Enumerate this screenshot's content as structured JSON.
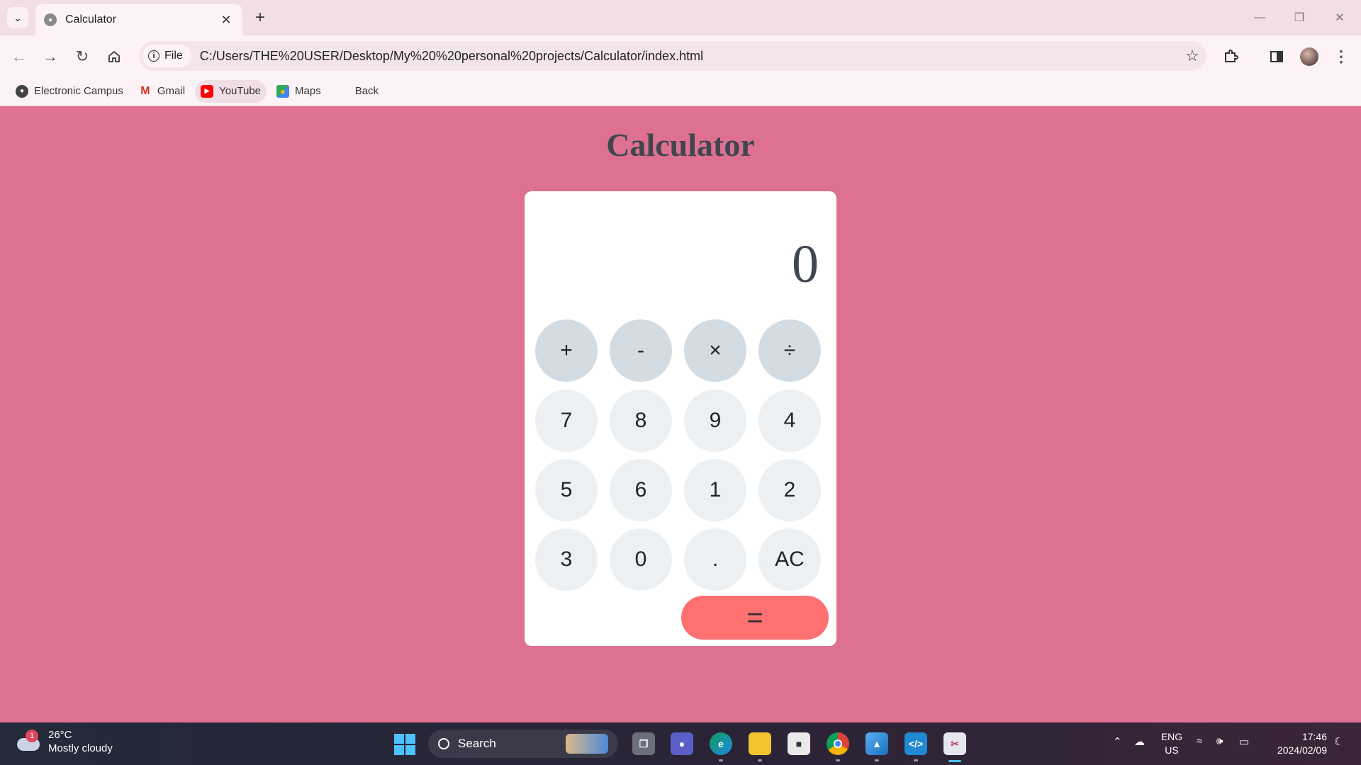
{
  "browser": {
    "tab_title": "Calculator",
    "site_chip": "File",
    "url": "C:/Users/THE%20USER/Desktop/My%20%20personal%20projects/Calculator/index.html",
    "bookmarks": [
      {
        "label": "Electronic Campus",
        "icon": "globe-icon"
      },
      {
        "label": "Gmail",
        "icon": "gmail-icon"
      },
      {
        "label": "YouTube",
        "icon": "youtube-icon"
      },
      {
        "label": "Maps",
        "icon": "maps-icon"
      },
      {
        "label": "Back",
        "icon": "windows-logo-icon"
      }
    ]
  },
  "page": {
    "title": "Calculator",
    "display_value": "0",
    "operators": [
      "+",
      "-",
      "×",
      "÷"
    ],
    "keys": [
      "7",
      "8",
      "9",
      "4",
      "5",
      "6",
      "1",
      "2",
      "3",
      "0",
      ".",
      "AC"
    ],
    "equals_label": "="
  },
  "taskbar": {
    "weather_temp": "26°C",
    "weather_desc": "Mostly cloudy",
    "weather_badge": "1",
    "search_label": "Search",
    "lang_primary": "ENG",
    "lang_secondary": "US",
    "time": "17:46",
    "date": "2024/02/09"
  },
  "colors": {
    "page_background": "#de7191",
    "operator_key": "#d3dbe3",
    "number_key": "#edf0f2",
    "equals_key": "#ff7071",
    "title_text": "#3f4650"
  }
}
